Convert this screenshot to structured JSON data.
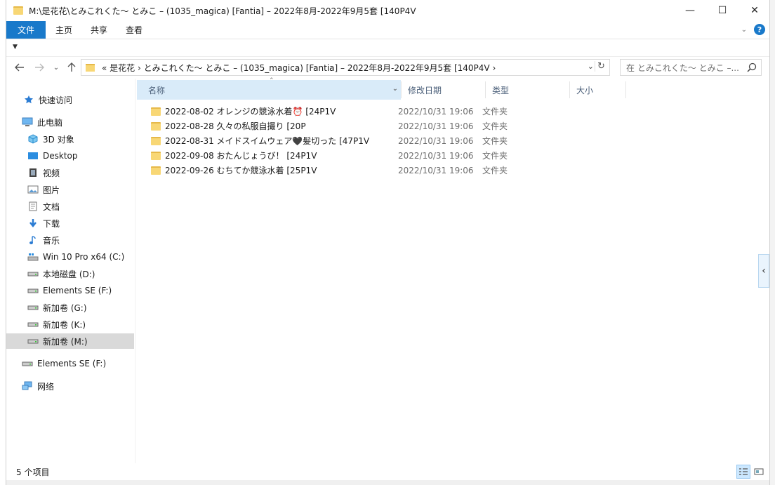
{
  "window": {
    "title": "M:\\是花花\\とみこれくた〜 とみこ – (1035_magica) [Fantia] – 2022年8月-2022年9月5套 [140P4V",
    "minimize_label": "—",
    "maximize_label": "☐",
    "close_label": "✕"
  },
  "ribbon": {
    "file_tab": "文件",
    "tabs": [
      "主页",
      "共享",
      "查看"
    ],
    "help_label": "?"
  },
  "address_bar": {
    "path_text": "«  是花花   ›   とみこれくた〜 とみこ – (1035_magica) [Fantia] – 2022年8月-2022年9月5套 [140P4V   ›"
  },
  "search": {
    "placeholder": "在 とみこれくた〜 とみこ –..."
  },
  "sidebar": {
    "quick_access": "快速访问",
    "this_pc": "此电脑",
    "items": [
      {
        "label": "3D 对象",
        "icon": "3d-objects-icon"
      },
      {
        "label": "Desktop",
        "icon": "desktop-icon"
      },
      {
        "label": "视频",
        "icon": "video-icon"
      },
      {
        "label": "图片",
        "icon": "pictures-icon"
      },
      {
        "label": "文档",
        "icon": "documents-icon"
      },
      {
        "label": "下载",
        "icon": "download-icon"
      },
      {
        "label": "音乐",
        "icon": "music-icon"
      },
      {
        "label": "Win 10 Pro x64 (C:)",
        "icon": "system-drive-icon"
      },
      {
        "label": "本地磁盘 (D:)",
        "icon": "drive-icon"
      },
      {
        "label": "Elements SE (F:)",
        "icon": "drive-icon"
      },
      {
        "label": "新加卷 (G:)",
        "icon": "drive-icon"
      },
      {
        "label": "新加卷 (K:)",
        "icon": "drive-icon"
      },
      {
        "label": "新加卷 (M:)",
        "icon": "drive-icon"
      }
    ],
    "external": "Elements SE (F:)",
    "network": "网络"
  },
  "columns": {
    "name": "名称",
    "modified": "修改日期",
    "type": "类型",
    "size": "大小"
  },
  "files": [
    {
      "name": "2022-08-02 オレンジの競泳水着⏰ [24P1V",
      "modified": "2022/10/31 19:06",
      "type": "文件夹"
    },
    {
      "name": "2022-08-28 久々の私服自撮り [20P",
      "modified": "2022/10/31 19:06",
      "type": "文件夹"
    },
    {
      "name": "2022-08-31 メイドスイムウェア🖤髪切った [47P1V",
      "modified": "2022/10/31 19:06",
      "type": "文件夹"
    },
    {
      "name": "2022-09-08 おたんじょうび！ [24P1V",
      "modified": "2022/10/31 19:06",
      "type": "文件夹"
    },
    {
      "name": "2022-09-26 むちてか競泳水着 [25P1V",
      "modified": "2022/10/31 19:06",
      "type": "文件夹"
    }
  ],
  "status": {
    "item_count": "5 个项目"
  },
  "colors": {
    "accent": "#1979ca",
    "selection": "#cce8ff",
    "folder": "#f8d775"
  }
}
